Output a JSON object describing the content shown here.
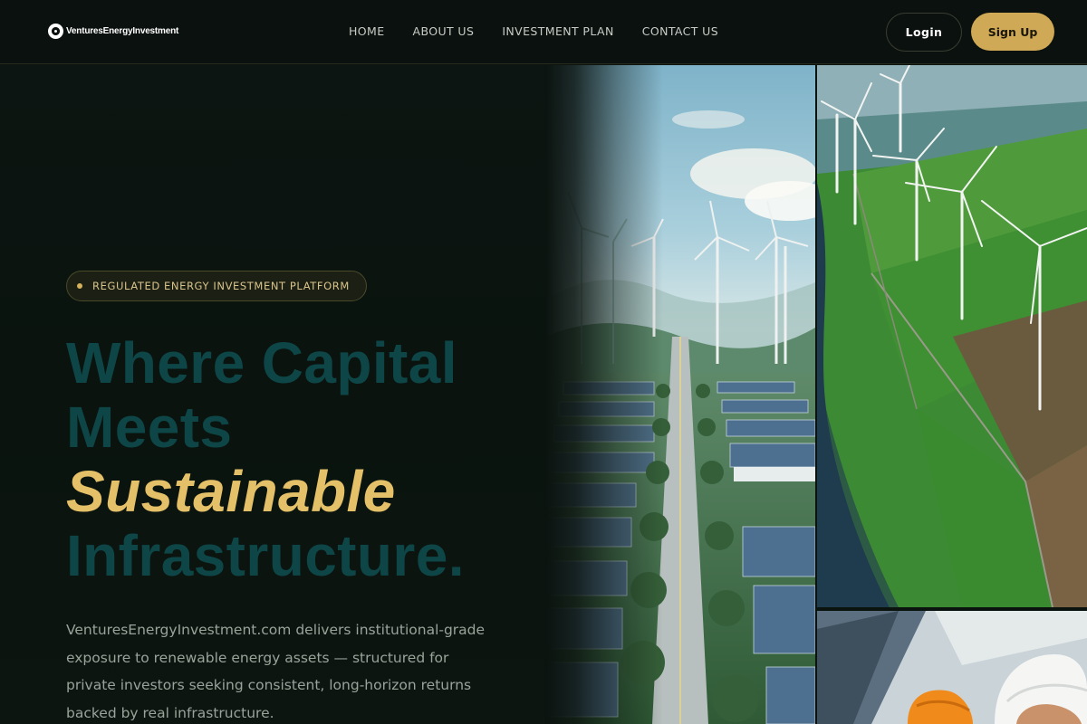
{
  "brand": {
    "name": "VenturesEnergyInvestment"
  },
  "nav": {
    "items": [
      {
        "label": "HOME"
      },
      {
        "label": "ABOUT US"
      },
      {
        "label": "INVESTMENT PLAN"
      },
      {
        "label": "CONTACT US"
      }
    ]
  },
  "auth": {
    "login_label": "Login",
    "signup_label": "Sign Up"
  },
  "hero": {
    "badge": "REGULATED ENERGY INVESTMENT PLATFORM",
    "headline_line1": "Where Capital",
    "headline_line2": "Meets",
    "headline_accent": "Sustainable",
    "headline_line4": "Infrastructure.",
    "description": "VenturesEnergyInvestment.com delivers institutional-grade exposure to renewable energy assets — structured for private investors seeking consistent, long-horizon returns backed by real infrastructure."
  },
  "images": {
    "main": "solar-farm-road-photo",
    "wind": "wind-farm-aerial-photo",
    "engineers": "engineers-hardhat-photo"
  },
  "colors": {
    "background": "#0b130f",
    "accent_gold": "#cfa955",
    "headline_teal": "#0e4647",
    "headline_gold": "#e4c068"
  }
}
